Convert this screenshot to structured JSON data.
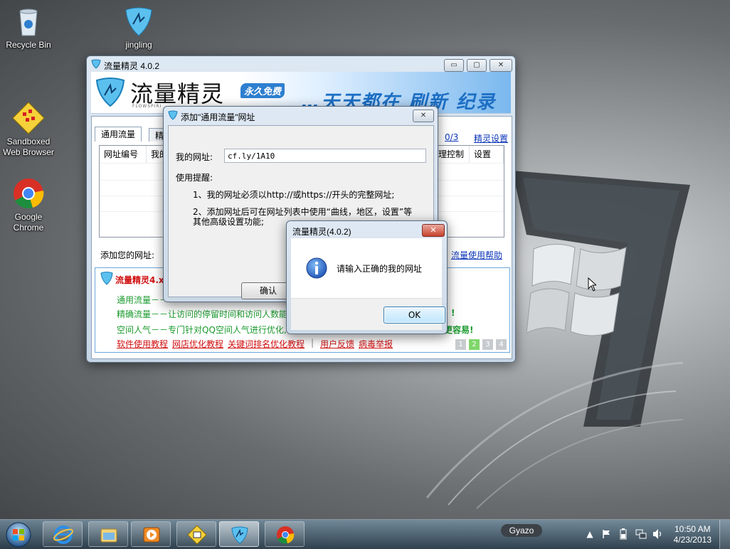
{
  "desktop": {
    "icons": [
      {
        "label": "Recycle Bin"
      },
      {
        "label": "jingling"
      },
      {
        "label": "Sandboxed\nWeb Browser"
      },
      {
        "label": "Google\nChrome"
      }
    ]
  },
  "main_window": {
    "title": "流量精灵 4.0.2",
    "banner": {
      "title": "流量精灵",
      "subtitle": "FLOWSPIRI",
      "tag": "永久免费",
      "slogan": "…天天都在 刷新 纪录"
    },
    "tabs": [
      "通用流量",
      "精"
    ],
    "counter": "0/3",
    "settings_link": "精灵设置",
    "columns": [
      "网址编号",
      "我的",
      "理控制",
      "设置"
    ],
    "add_url_label": "添加您的网址:",
    "help_link": "流量使用帮助",
    "info": {
      "heading": "流量精灵4.x",
      "lines": [
        "通用流量－－",
        "精确流量－－让访问的停留时间和访问人数能",
        "空间人气－－专门针对QQ空间人气进行优化,"
      ],
      "tail_1": "!",
      "tail_2": "更容易!",
      "links": [
        "软件使用教程",
        "网店优化教程",
        "关键词排名优化教程",
        "用户反馈",
        "病毒举报"
      ],
      "separator": "|",
      "pages": [
        "1",
        "2",
        "3",
        "4"
      ],
      "active_page": 2
    },
    "controls": {
      "minimize": "▭",
      "maximize": "▢",
      "close": "✕"
    }
  },
  "add_dialog": {
    "title": "添加\"通用流量\"网址",
    "url_label": "我的网址:",
    "url_value": "cf.ly/1A10",
    "tips_heading": "使用提醒:",
    "tip_1": "1、我的网址必须以http://或https://开头的完整网址;",
    "tip_2a": "2、添加网址后可在网址列表中使用“曲线，地区，设置”等",
    "tip_2b": "其他高级设置功能;",
    "confirm_button": "确认",
    "close": "✕"
  },
  "message_box": {
    "title": "流量精灵(4.0.2)",
    "message": "请输入正确的我的网址",
    "ok_button": "OK",
    "close": "✕"
  },
  "taskbar": {
    "gyazo": "Gyazo",
    "time": "10:50 AM",
    "date": "4/23/2013",
    "tray_arrow": "▲"
  }
}
